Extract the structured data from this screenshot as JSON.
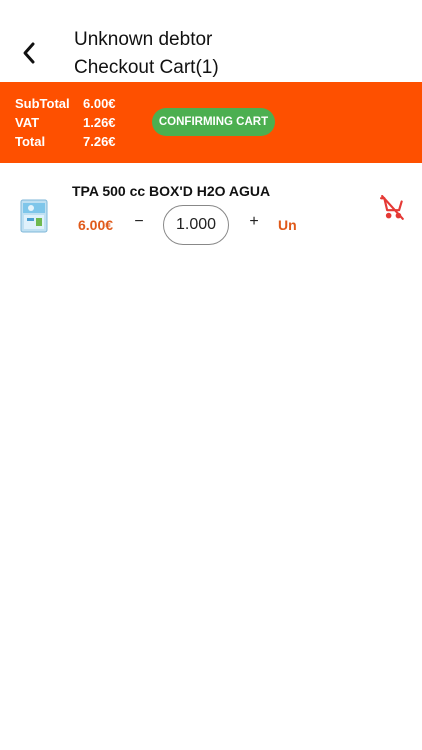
{
  "header": {
    "title_line1": "Unknown debtor",
    "title_line2": "Checkout Cart(1)"
  },
  "summary": {
    "subtotal_label": "SubTotal",
    "subtotal_value": "6.00€",
    "vat_label": "VAT",
    "vat_value": "1.26€",
    "total_label": "Total",
    "total_value": "7.26€",
    "confirm_label": "CONFIRMING CART",
    "bg_color": "#fe5000",
    "button_color": "#4caf50"
  },
  "cart": {
    "items": [
      {
        "name": "TPA 500 cc BOX'D H2O AGUA",
        "price": "6.00€",
        "quantity": "1.000",
        "minus": "−",
        "plus": "+",
        "unit": "Un",
        "remove_icon": "remove-from-cart-icon"
      }
    ]
  }
}
